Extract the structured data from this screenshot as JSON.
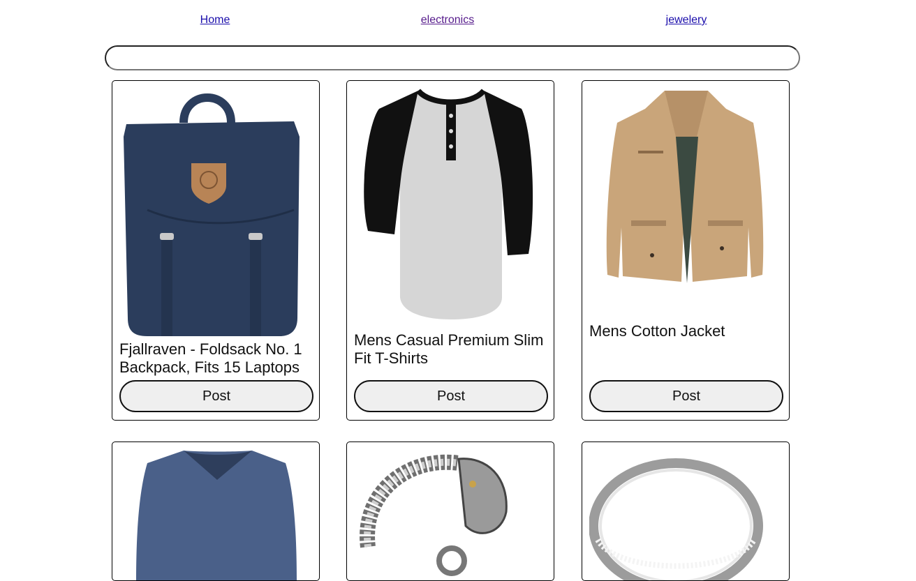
{
  "nav": {
    "home": "Home",
    "electronics": "electronics",
    "jewelery": "jewelery"
  },
  "search": {
    "value": "",
    "placeholder": ""
  },
  "products": [
    {
      "title": "Fjallraven - Foldsack No. 1 Backpack, Fits 15 Laptops",
      "button": "Post",
      "image": "navy-backpack"
    },
    {
      "title": "Mens Casual Premium Slim Fit T-Shirts",
      "button": "Post",
      "image": "raglan-henley-shirt"
    },
    {
      "title": "Mens Cotton Jacket",
      "button": "Post",
      "image": "khaki-jacket"
    },
    {
      "title": "",
      "button": "",
      "image": "blue-vneck-shirt"
    },
    {
      "title": "",
      "button": "",
      "image": "dragon-chain-bracelet"
    },
    {
      "title": "",
      "button": "",
      "image": "diamond-ring"
    }
  ],
  "colors": {
    "link": "#1a0dab",
    "link_visited": "#551a8b",
    "button_bg": "#efefef",
    "backpack": "#2b3d5c",
    "jacket": "#c9a57a",
    "shirt_blue": "#4a6089"
  }
}
